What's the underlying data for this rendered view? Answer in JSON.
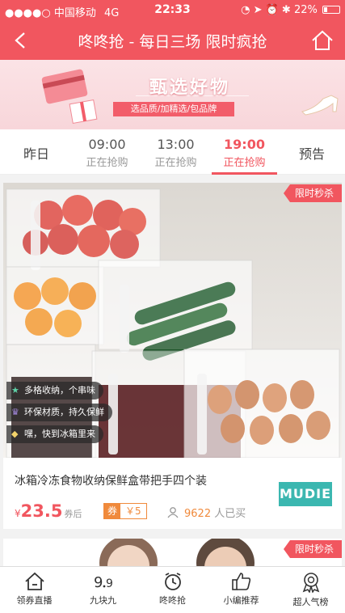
{
  "status_bar": {
    "carrier": "●●●●○ 中国移动",
    "network": "4G",
    "time": "22:33",
    "battery": "22%"
  },
  "nav": {
    "title": "咚咚抢 - 每日三场 限时疯抢"
  },
  "banner": {
    "heading": "甄选好物",
    "subtitle": "选品质/加精选/包品牌"
  },
  "tabs": [
    {
      "label": "昨日"
    },
    {
      "time": "09:00",
      "status": "正在抢购"
    },
    {
      "time": "13:00",
      "status": "正在抢购"
    },
    {
      "time": "19:00",
      "status": "正在抢购",
      "active": true
    },
    {
      "label": "预告"
    }
  ],
  "product": {
    "badge": "限时秒杀",
    "features": [
      "多格收纳，个串味",
      "环保材质，持久保鲜",
      "嘿，快到冰箱里来"
    ],
    "title": "冰箱冷冻食物收纳保鲜盒带把手四个装",
    "price_symbol": "¥",
    "price": "23.5",
    "price_suffix": "券后",
    "coupon_tag": "券",
    "coupon_value": "￥5",
    "sold_count": "9622",
    "sold_suffix": " 人已买",
    "brand_logo": "MUDIE"
  },
  "product2": {
    "badge": "限时秒杀"
  },
  "tabbar": [
    {
      "label": "领券直播",
      "icon": "home-icon"
    },
    {
      "label": "九块九",
      "icon": "nine-nine-icon"
    },
    {
      "label": "咚咚抢",
      "icon": "alarm-clock-icon"
    },
    {
      "label": "小编推荐",
      "icon": "thumbs-up-icon"
    },
    {
      "label": "超人气榜",
      "icon": "medal-icon"
    }
  ],
  "colors": {
    "accent": "#f1565f",
    "coupon": "#f08a3c",
    "brand": "#3bb7b0"
  }
}
